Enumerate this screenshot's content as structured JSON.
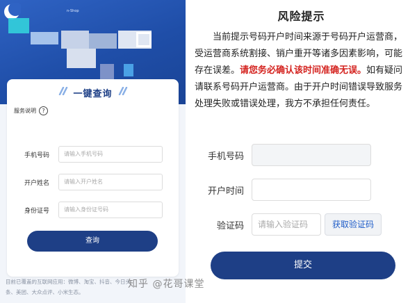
{
  "left": {
    "brand_text": "n-Shop",
    "card": {
      "title": "一键查询",
      "service_note": "服务说明",
      "help_symbol": "?",
      "fields": [
        {
          "label": "手机号码",
          "placeholder": "请输入手机号码"
        },
        {
          "label": "开户姓名",
          "placeholder": "请输入开户姓名"
        },
        {
          "label": "身份证号",
          "placeholder": "请输入身份证号码"
        }
      ],
      "query_button": "查询"
    },
    "footnote_line1": "目前已覆盖的互联网应用：微博、淘宝、抖音、今日头",
    "footnote_line2": "条、美团、大众点评、小米生态。"
  },
  "right": {
    "title": "风险提示",
    "notice": {
      "part1": "当前提示号码开户时间来源于号码开户运营商，受运营商系统割接、销户重开等诸多因素影响，可能存在误差。",
      "warning": "请您务必确认该时间准确无误。",
      "part2": "如有疑问请联系号码开户运营商。由于开户时间错误导致服务处理失败或错误处理，我方不承担任何责任。"
    },
    "phone_label": "手机号码",
    "phone_value": "",
    "open_time_label": "开户时间",
    "open_time_value": "",
    "code_label": "验证码",
    "code_placeholder": "请输入验证码",
    "get_code_button": "获取验证码",
    "submit_button": "提交"
  },
  "watermark": "知乎 @花哥课堂",
  "colors": {
    "primary_navy": "#1e3f86",
    "hero_blue": "#2a5bbb",
    "warning_red": "#d4231f",
    "link_blue": "#1e5cc8"
  }
}
